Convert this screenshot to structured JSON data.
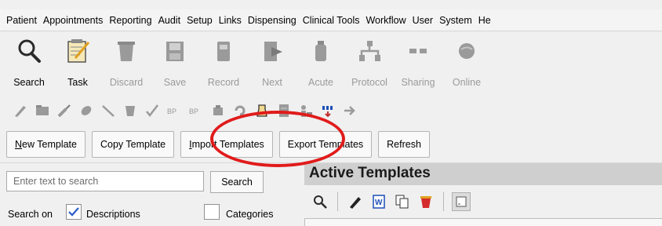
{
  "menubar": {
    "items": [
      "Patient",
      "Appointments",
      "Reporting",
      "Audit",
      "Setup",
      "Links",
      "Dispensing",
      "Clinical Tools",
      "Workflow",
      "User",
      "System",
      "He"
    ]
  },
  "toolbar": {
    "buttons": [
      {
        "label": "Search",
        "icon": "magnifier-icon",
        "enabled": true
      },
      {
        "label": "Task",
        "icon": "notepad-pencil-icon",
        "enabled": true
      },
      {
        "label": "Discard",
        "icon": "discard-icon",
        "enabled": false
      },
      {
        "label": "Save",
        "icon": "floppy-icon",
        "enabled": false
      },
      {
        "label": "Record",
        "icon": "record-icon",
        "enabled": false
      },
      {
        "label": "Next",
        "icon": "next-icon",
        "enabled": false
      },
      {
        "label": "Acute",
        "icon": "bottle-icon",
        "enabled": false
      },
      {
        "label": "Protocol",
        "icon": "protocol-icon",
        "enabled": false
      },
      {
        "label": "Sharing",
        "icon": "sharing-icon",
        "enabled": false
      },
      {
        "label": "Online",
        "icon": "online-icon",
        "enabled": false
      }
    ]
  },
  "smalltoolbar": {
    "icons": [
      "pen-icon",
      "folder-icon",
      "syringe-icon",
      "pill-icon",
      "scalpel-icon",
      "cup-icon",
      "check-pen-icon",
      "bp-icon",
      "bp2-icon",
      "medicine-icon",
      "recycle-icon",
      "beaker-icon",
      "report-icon",
      "people-icon",
      "ecg-icon",
      "arrow-right-icon"
    ],
    "bp_labels": [
      "BP",
      "BP"
    ]
  },
  "actions": {
    "new_template": "New Template",
    "copy_template": "Copy Template",
    "import_templates": "Import Templates",
    "export_templates": "Export Templates",
    "refresh": "Refresh"
  },
  "search": {
    "placeholder": "Enter text to search",
    "button": "Search",
    "search_on_label": "Search on",
    "descriptions_label": "Descriptions",
    "descriptions_checked": true,
    "categories_label": "Categories",
    "categories_checked": false
  },
  "templates": {
    "title": "Active Templates",
    "toolbar_icons": [
      "search-icon",
      "edit-pencil-icon",
      "word-doc-icon",
      "copy-icon",
      "delete-icon",
      "view-icon"
    ]
  },
  "colors": {
    "highlight": "#e11b1b",
    "title_bar": "#cfcfcf",
    "disabled_text": "#9a9a9a"
  }
}
